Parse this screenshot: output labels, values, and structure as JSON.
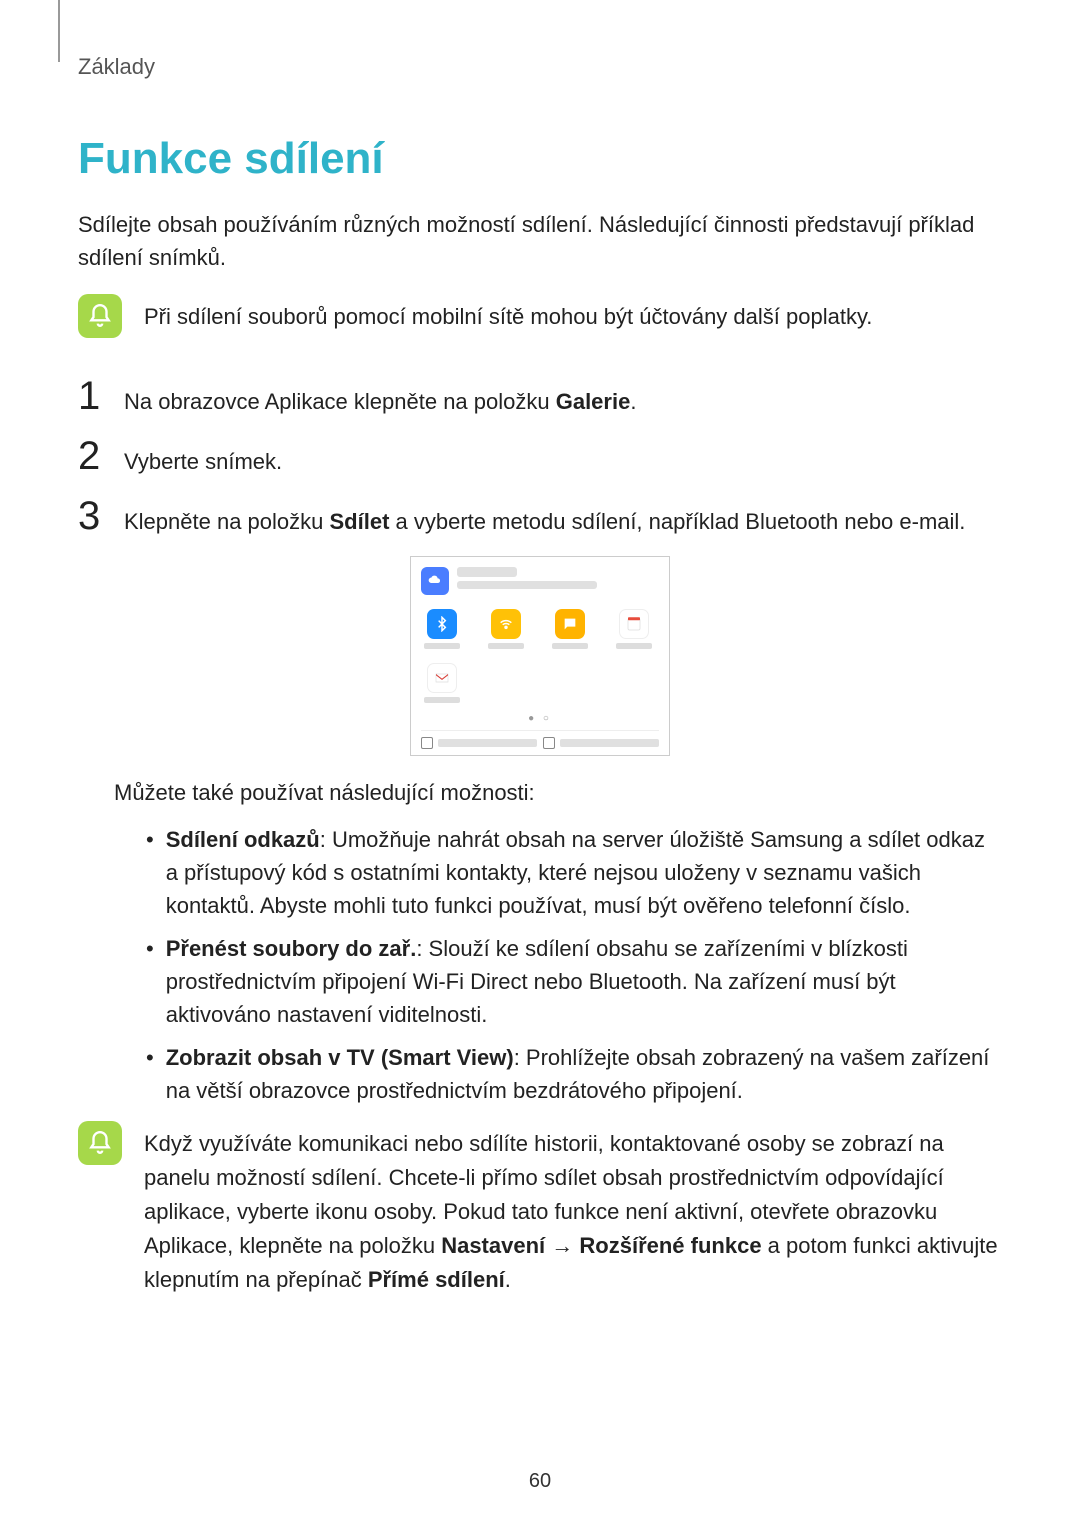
{
  "header": "Základy",
  "title": "Funkce sdílení",
  "intro": "Sdílejte obsah používáním různých možností sdílení. Následující činnosti představují příklad sdílení snímků.",
  "notice1": "Při sdílení souborů pomocí mobilní sítě mohou být účtovány další poplatky.",
  "steps": {
    "s1": {
      "num": "1",
      "pre": "Na obrazovce Aplikace klepněte na položku ",
      "bold": "Galerie",
      "post": "."
    },
    "s2": {
      "num": "2",
      "text": "Vyberte snímek."
    },
    "s3": {
      "num": "3",
      "pre": "Klepněte na položku ",
      "bold": "Sdílet",
      "post": " a vyberte metodu sdílení, například Bluetooth nebo e-mail."
    }
  },
  "options_intro": "Můžete také používat následující možnosti:",
  "options": {
    "o1": {
      "bold": "Sdílení odkazů",
      "text": ": Umožňuje nahrát obsah na server úložiště Samsung a sdílet odkaz a přístupový kód s ostatními kontakty, které nejsou uloženy v seznamu vašich kontaktů. Abyste mohli tuto funkci používat, musí být ověřeno telefonní číslo."
    },
    "o2": {
      "bold": "Přenést soubory do zař.",
      "text": ": Slouží ke sdílení obsahu se zařízeními v blízkosti prostřednictvím připojení Wi-Fi Direct nebo Bluetooth. Na zařízení musí být aktivováno nastavení viditelnosti."
    },
    "o3": {
      "bold": "Zobrazit obsah v TV (Smart View)",
      "text": ": Prohlížejte obsah zobrazený na vašem zařízení na větší obrazovce prostřednictvím bezdrátového připojení."
    }
  },
  "notice2": {
    "pre": "Když využíváte komunikaci nebo sdílíte historii, kontaktované osoby se zobrazí na panelu možností sdílení. Chcete-li přímo sdílet obsah prostřednictvím odpovídající aplikace, vyberte ikonu osoby. Pokud tato funkce není aktivní, otevřete obrazovku Aplikace, klepněte na položku ",
    "b1": "Nastavení",
    "arrow": " → ",
    "b2": "Rozšířené funkce",
    "mid": " a potom funkci aktivujte klepnutím na přepínač ",
    "b3": "Přímé sdílení",
    "post": "."
  },
  "page_number": "60"
}
